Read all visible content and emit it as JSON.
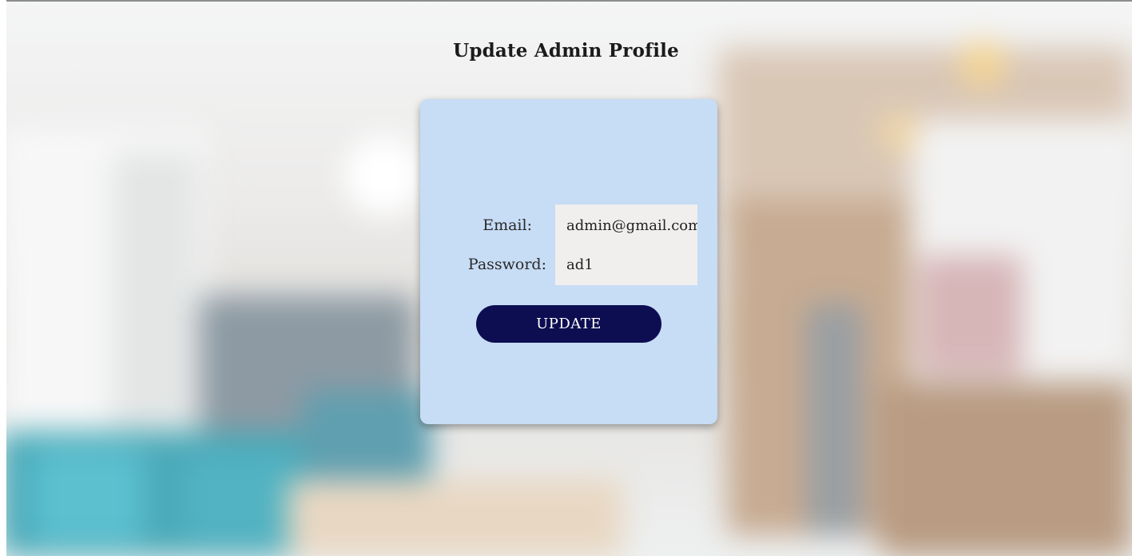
{
  "page": {
    "title": "Update Admin Profile"
  },
  "form": {
    "email_label": "Email:",
    "email_value": "admin@gmail.com",
    "password_label": "Password:",
    "password_value": "ad1",
    "submit_label": "UPDATE"
  },
  "colors": {
    "card_background": "#c7dcf5",
    "button_background": "#0d0d52",
    "input_background": "#f0efee"
  }
}
